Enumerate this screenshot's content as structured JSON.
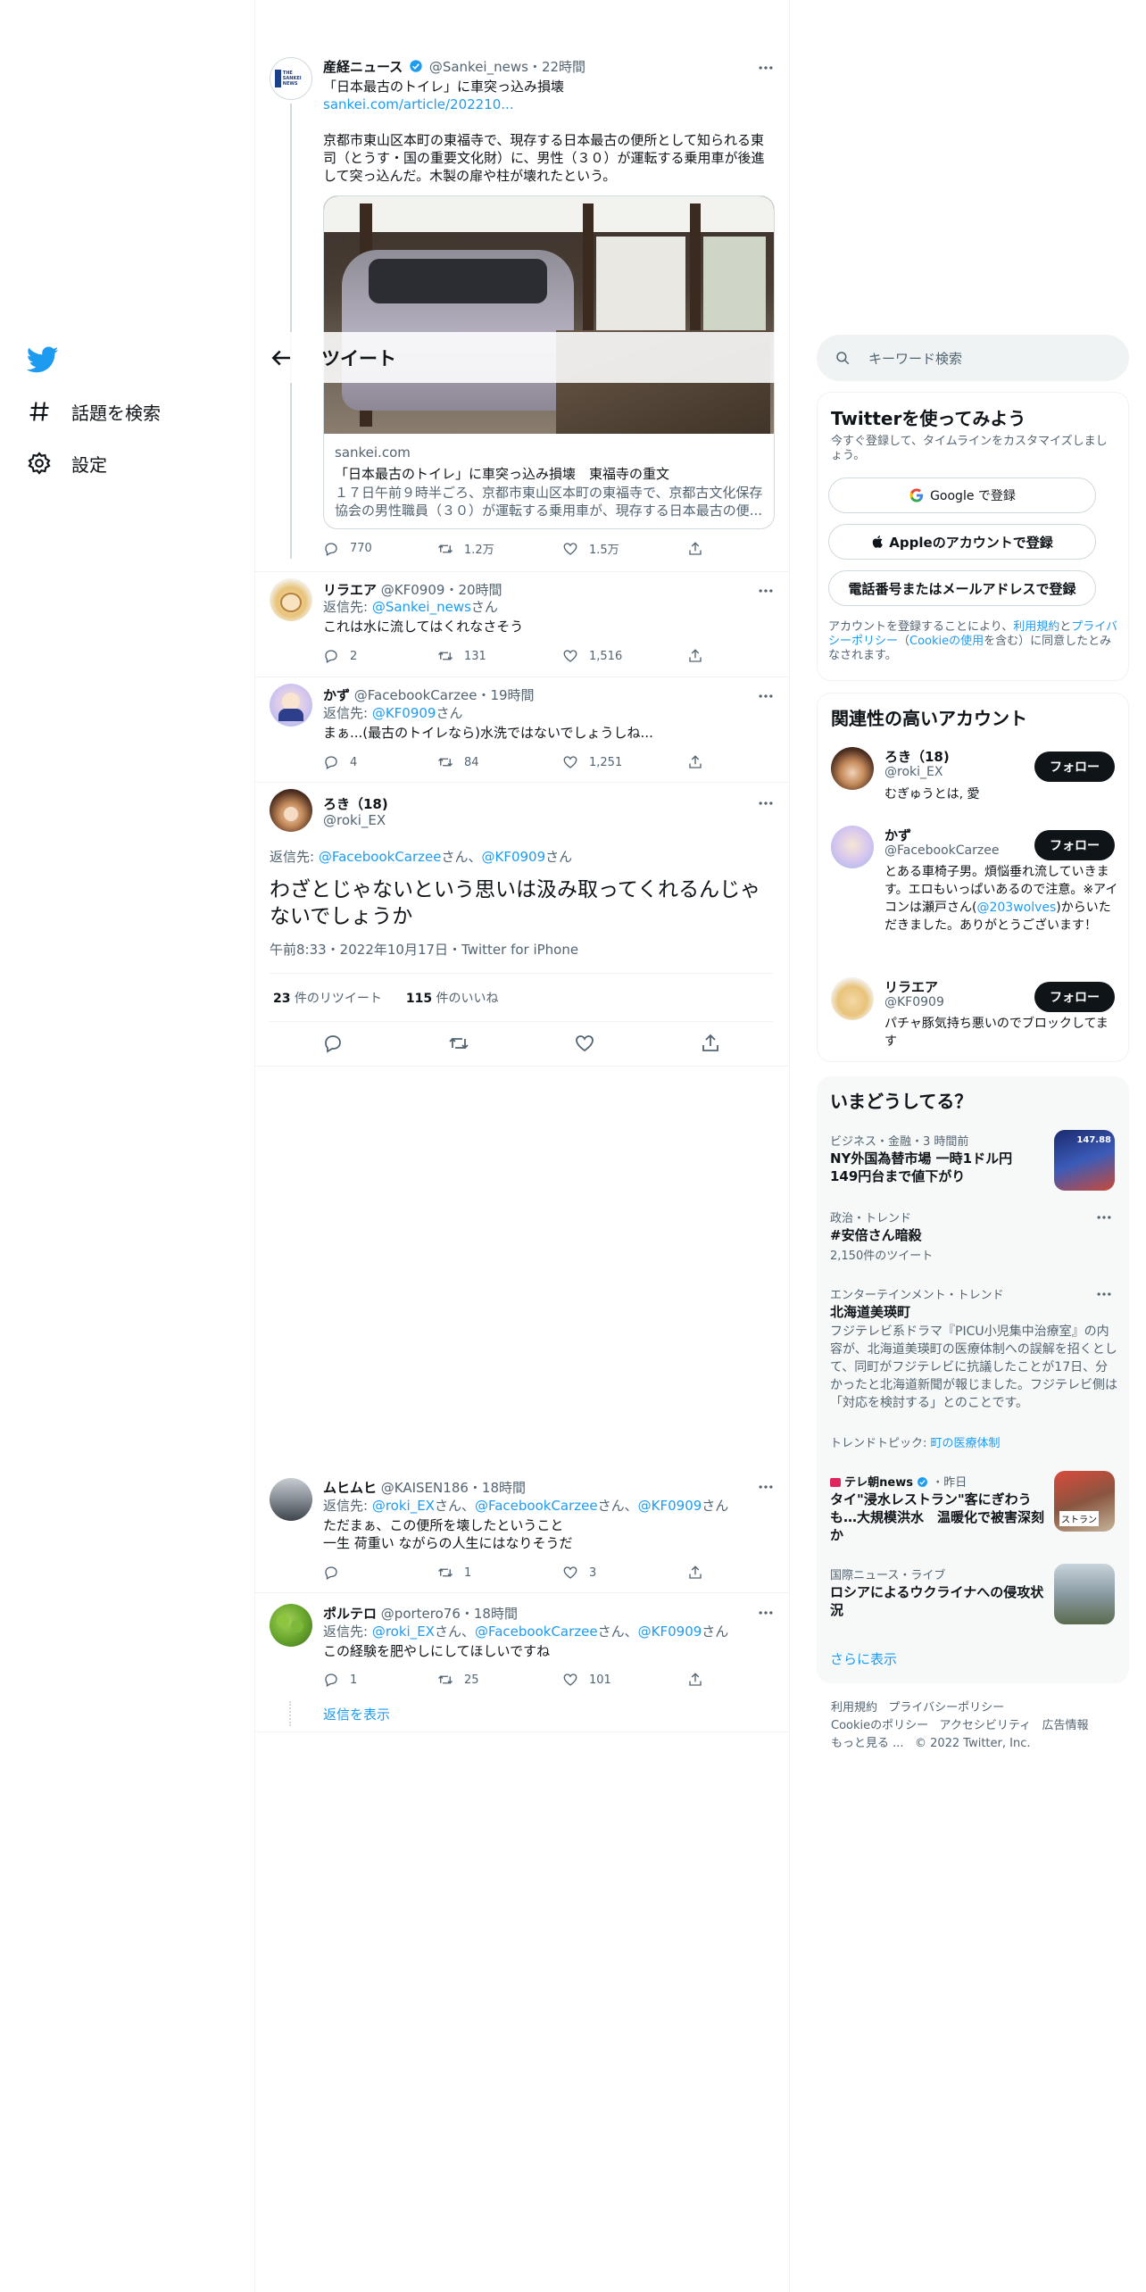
{
  "nav": {
    "items": [
      {
        "label": "話題を検索"
      },
      {
        "label": "設定"
      }
    ]
  },
  "header": {
    "title": "ツイート"
  },
  "main_tweet": {
    "name": "産経ニュース",
    "handle": "@Sankei_news",
    "time": "22時間",
    "text": "「日本最古のトイレ」に車突っ込み損壊",
    "link": "sankei.com/article/202210...",
    "body": "京都市東山区本町の東福寺で、現存する日本最古の便所として知られる東司（とうす・国の重要文化財）に、男性（３０）が運転する乗用車が後進して突っ込んだ。木製の扉や柱が壊れたという。",
    "card_domain": "sankei.com",
    "card_title": "「日本最古のトイレ」に車突っ込み損壊　東福寺の重文",
    "card_desc": "１７日午前９時半ごろ、京都市東山区本町の東福寺で、京都古文化保存協会の男性職員（３０）が運転する乗用車が、現存する日本最古の便...",
    "replies": "770",
    "retweets": "1.2万",
    "likes": "1.5万",
    "avatar_label": "THE SANKEI NEWS"
  },
  "reply1": {
    "name": "リラエア",
    "handle": "@KF0909",
    "time": "20時間",
    "reply_prefix": "返信先: ",
    "reply_to": "@Sankei_news",
    "reply_suffix": "さん",
    "text": "これは水に流してはくれなさそう",
    "replies": "2",
    "retweets": "131",
    "likes": "1,516"
  },
  "reply2": {
    "name": "かず",
    "handle": "@FacebookCarzee",
    "time": "19時間",
    "reply_prefix": "返信先: ",
    "reply_to": "@KF0909",
    "reply_suffix": "さん",
    "text": "まぁ...(最古のトイレなら)水洗ではないでしょうしね...",
    "replies": "4",
    "retweets": "84",
    "likes": "1,251"
  },
  "focus": {
    "name": "ろき（18)",
    "handle": "@roki_EX",
    "reply_prefix": "返信先: ",
    "reply_to1": "@FacebookCarzee",
    "mid": "さん、",
    "reply_to2": "@KF0909",
    "reply_suffix": "さん",
    "text": "わざとじゃないという思いは汲み取ってくれるんじゃないでしょうか",
    "meta": "午前8:33・2022年10月17日・Twitter for iPhone",
    "retweet_count": "23",
    "retweet_label": " 件のリツイート",
    "like_count": "115",
    "like_label": " 件のいいね"
  },
  "reply3": {
    "name": "ムヒムヒ",
    "handle": "@KAISEN186",
    "time": "18時間",
    "reply_prefix": "返信先: ",
    "to1": "@roki_EX",
    "to2": "@FacebookCarzee",
    "to3": "@KF0909",
    "san": "さん、",
    "san_end": "さん",
    "line1": "ただまぁ、この便所を壊したということ",
    "line2": "一生 荷重い ながらの人生にはなりそうだ",
    "retweets": "1",
    "likes": "3"
  },
  "reply4": {
    "name": "ポルテロ",
    "handle": "@portero76",
    "time": "18時間",
    "reply_prefix": "返信先: ",
    "to1": "@roki_EX",
    "to2": "@FacebookCarzee",
    "to3": "@KF0909",
    "san": "さん、",
    "san_end": "さん",
    "text": "この経験を肥やしにしてほしいですね",
    "replies": "1",
    "retweets": "25",
    "likes": "101",
    "show_replies": "返信を表示"
  },
  "search": {
    "placeholder": "キーワード検索"
  },
  "signup": {
    "title": "Twitterを使ってみよう",
    "subtitle": "今すぐ登録して、タイムラインをカスタマイズしましょう。",
    "google": "Google で登録",
    "apple": "Appleのアカウントで登録",
    "phone": "電話番号またはメールアドレスで登録",
    "legal_1": "アカウントを登録することにより、",
    "terms": "利用規約",
    "legal_2": "と",
    "privacy": "プライバシーポリシー",
    "legal_3": "（",
    "cookie": "Cookieの使用",
    "legal_4": "を含む）に同意したとみなされます。"
  },
  "relevant": {
    "title": "関連性の高いアカウント",
    "follow_label": "フォロー",
    "accounts": [
      {
        "name": "ろき（18)",
        "handle": "@roki_EX",
        "bio": "むぎゅうとは, 愛"
      },
      {
        "name": "かず",
        "handle": "@FacebookCarzee",
        "bio_1": "とある車椅子男。煩悩垂れ流していきます。エロもいっぱいあるので注意。※アイコンは瀬戸さん(",
        "bio_link": "@203wolves",
        "bio_2": ")からいただきました。ありがとうございます！"
      },
      {
        "name": "リラエア",
        "handle": "@KF0909",
        "bio": "パチャ豚気持ち悪いのでブロックしてます"
      }
    ]
  },
  "trends": {
    "title": "いまどうしてる？",
    "items": [
      {
        "category": "ビジネス・金融・3 時間前",
        "title": "NY外国為替市場 一時1ドル円149円台まで値下がり",
        "thumb_label": "147.88"
      },
      {
        "category": "政治・トレンド",
        "title": "#安倍さん暗殺",
        "count": "2,150件のツイート"
      },
      {
        "category": "エンターテインメント・トレンド",
        "title": "北海道美瑛町",
        "desc": "フジテレビ系ドラマ『PICU小児集中治療室』の内容が、北海道美瑛町の医療体制への誤解を招くとして、同町がフジテレビに抗議したことが17日、分かったと北海道新聞が報じました。フジテレビ側は「対応を検討する」とのことです。",
        "topic_prefix": "トレンドトピック: ",
        "topic": "町の医療体制"
      },
      {
        "source": "テレ朝news",
        "time": "・昨日",
        "title": "タイ\"浸水レストラン\"客にぎわうも…大規模洪水　温暖化で被害深刻か",
        "thumb_label": "ストラン"
      },
      {
        "category": "国際ニュース・ライブ",
        "title": "ロシアによるウクライナへの侵攻状況"
      }
    ],
    "more": "さらに表示"
  },
  "footer": {
    "links1": [
      "利用規約",
      "プライバシーポリシー"
    ],
    "links2": [
      "Cookieのポリシー",
      "アクセシビリティ",
      "広告情報"
    ],
    "more": "もっと見る ...",
    "copyright": "© 2022 Twitter, Inc."
  },
  "colors": {
    "accent": "#1d9bf0",
    "text": "#0f1419",
    "muted": "#536471",
    "verified": "#1d9bf0"
  }
}
